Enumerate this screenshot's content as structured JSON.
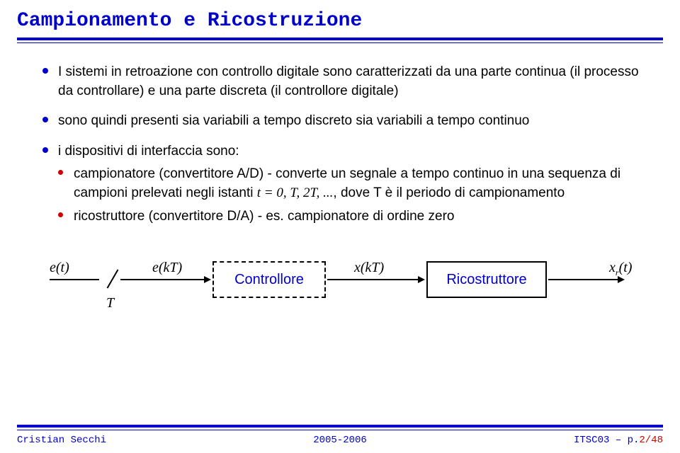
{
  "title": "Campionamento e Ricostruzione",
  "bullets": {
    "b1": "I sistemi in retroazione con controllo digitale sono caratterizzati da una parte continua (il processo da controllare) e una parte discreta (il controllore digitale)",
    "b2": "sono quindi presenti sia variabili a tempo discreto sia variabili a tempo continuo",
    "b3": "i dispositivi di interfaccia sono:",
    "b3a_pre": "campionatore (convertitore A/D) - converte un segnale a tempo continuo in una sequenza di campioni prelevati negli istanti ",
    "b3a_math": "t = 0, T, 2T, ...",
    "b3a_post": ", dove T è il periodo di campionamento",
    "b3b": "ricostruttore (convertitore D/A) - es. campionatore di ordine zero"
  },
  "diagram": {
    "e_t": "e(t)",
    "T": "T",
    "e_kT": "e(kT)",
    "controller": "Controllore",
    "x_kT": "x(kT)",
    "reconstructor": "Ricostruttore",
    "xr_t": "x_r(t)"
  },
  "footer": {
    "author": "Cristian Secchi",
    "year": "2005-2006",
    "code": "ITSC03 – p.",
    "page": "2/48"
  }
}
